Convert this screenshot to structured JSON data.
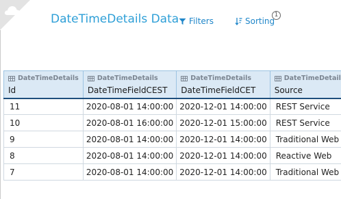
{
  "header": {
    "title": "DateTimeDetails Data",
    "filters_label": "Filters",
    "sorting_label": "Sorting",
    "info_icon_glyph": "1"
  },
  "colors": {
    "title": "#2e9fd7",
    "link": "#1f86c9",
    "header_bg": "#dbe9f5",
    "header_border": "#1e4e7c"
  },
  "table": {
    "entity": "DateTimeDetails",
    "columns": [
      {
        "entity": "DateTimeDetails",
        "name": "Id"
      },
      {
        "entity": "DateTimeDetails",
        "name": "DateTimeFieldCEST"
      },
      {
        "entity": "DateTimeDetails",
        "name": "DateTimeFieldCET"
      },
      {
        "entity": "DateTimeDetails",
        "name": "Source"
      }
    ],
    "rows": [
      [
        "11",
        "2020-08-01 14:00:00",
        "2020-12-01 14:00:00",
        "REST Service"
      ],
      [
        "10",
        "2020-08-01 16:00:00",
        "2020-12-01 15:00:00",
        "REST Service"
      ],
      [
        "9",
        "2020-08-01 14:00:00",
        "2020-12-01 14:00:00",
        "Traditional Web"
      ],
      [
        "8",
        "2020-08-01 14:00:00",
        "2020-12-01 14:00:00",
        "Reactive Web"
      ],
      [
        "7",
        "2020-08-01 14:00:00",
        "2020-12-01 14:00:00",
        "Traditional Web"
      ]
    ]
  },
  "icons": {
    "corner": "cloud-icon",
    "filters": "filter-icon",
    "sorting": "sort-icon",
    "column": "table-icon",
    "info": "info-icon"
  }
}
